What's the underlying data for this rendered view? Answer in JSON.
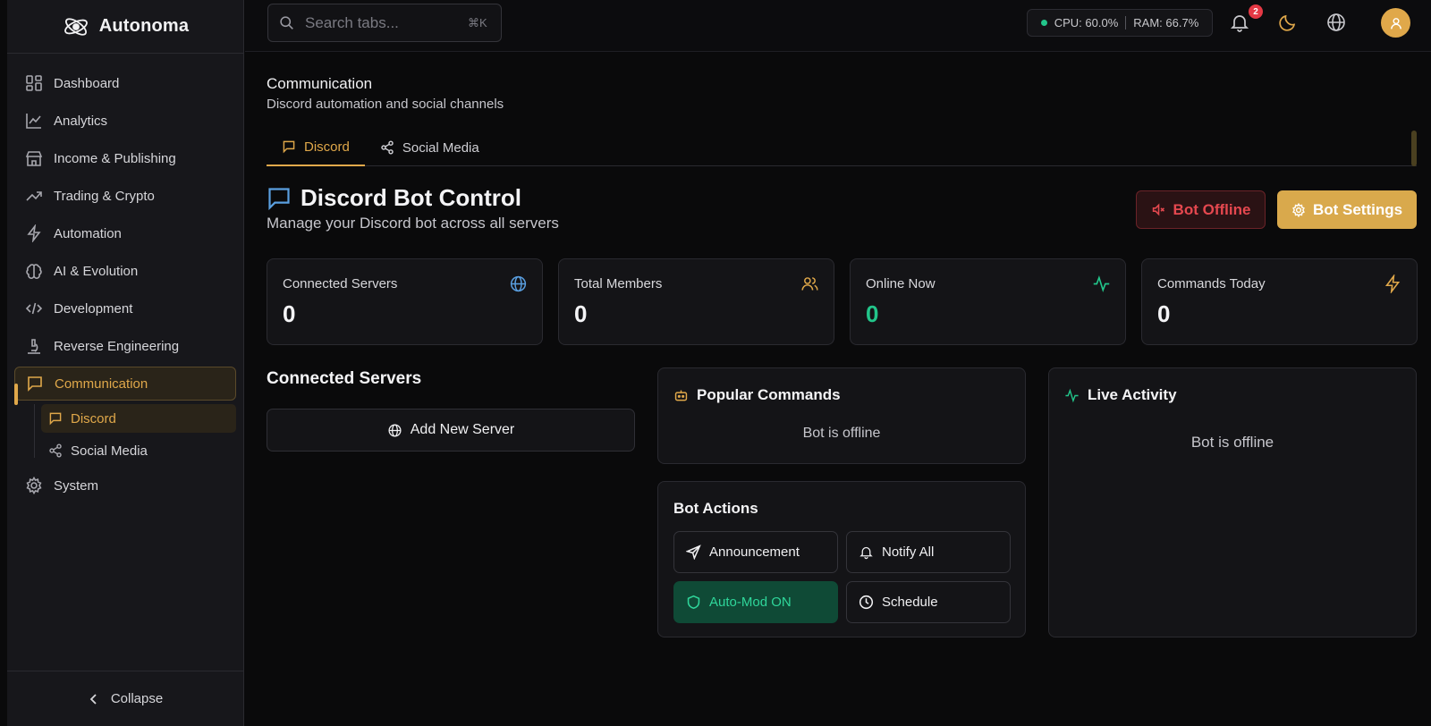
{
  "brand": {
    "name": "Autonoma"
  },
  "sidebar": {
    "items": [
      {
        "label": "Dashboard"
      },
      {
        "label": "Analytics"
      },
      {
        "label": "Income & Publishing"
      },
      {
        "label": "Trading & Crypto"
      },
      {
        "label": "Automation"
      },
      {
        "label": "AI & Evolution"
      },
      {
        "label": "Development"
      },
      {
        "label": "Reverse Engineering"
      },
      {
        "label": "Communication"
      },
      {
        "label": "System"
      }
    ],
    "sub_items": [
      {
        "label": "Discord"
      },
      {
        "label": "Social Media"
      }
    ],
    "collapse_label": "Collapse"
  },
  "topbar": {
    "search_placeholder": "Search tabs...",
    "shortcut": "⌘K",
    "cpu": "CPU: 60.0%",
    "ram": "RAM: 66.7%",
    "notification_count": "2"
  },
  "page": {
    "title": "Communication",
    "subtitle": "Discord automation and social channels",
    "tabs": [
      {
        "label": "Discord"
      },
      {
        "label": "Social Media"
      }
    ]
  },
  "discord": {
    "title": "Discord Bot Control",
    "subtitle": "Manage your Discord bot across all servers",
    "status_button": "Bot Offline",
    "settings_button": "Bot Settings",
    "stats": [
      {
        "label": "Connected Servers",
        "value": "0"
      },
      {
        "label": "Total Members",
        "value": "0"
      },
      {
        "label": "Online Now",
        "value": "0"
      },
      {
        "label": "Commands Today",
        "value": "0"
      }
    ],
    "servers_title": "Connected Servers",
    "add_server_label": "Add New Server",
    "popular_title": "Popular Commands",
    "popular_empty": "Bot is offline",
    "actions_title": "Bot Actions",
    "actions": [
      {
        "label": "Announcement"
      },
      {
        "label": "Notify All"
      },
      {
        "label": "Auto-Mod ON"
      },
      {
        "label": "Schedule"
      }
    ],
    "activity_title": "Live Activity",
    "activity_empty": "Bot is offline"
  },
  "colors": {
    "accent": "#e0a84a",
    "success": "#22c58a",
    "danger": "#e5484f",
    "info": "#5a9fe0"
  }
}
